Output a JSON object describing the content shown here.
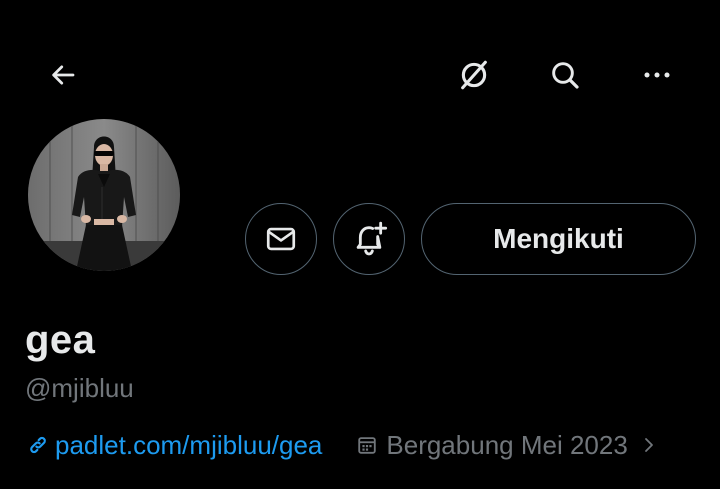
{
  "header": {
    "back_icon": "arrow-left-icon",
    "grok_icon": "grok-icon",
    "search_icon": "search-icon",
    "more_icon": "more-horizontal-icon"
  },
  "profile": {
    "display_name": "gea",
    "handle": "@mjibluu",
    "website": "padlet.com/mjibluu/gea",
    "joined": "Bergabung Mei 2023"
  },
  "actions": {
    "message_icon": "envelope-icon",
    "notify_icon": "bell-plus-icon",
    "follow_label": "Mengikuti"
  },
  "colors": {
    "background": "#000000",
    "text_primary": "#e7e9ea",
    "text_secondary": "#71767b",
    "link": "#1d9bf0",
    "border": "#536471"
  }
}
